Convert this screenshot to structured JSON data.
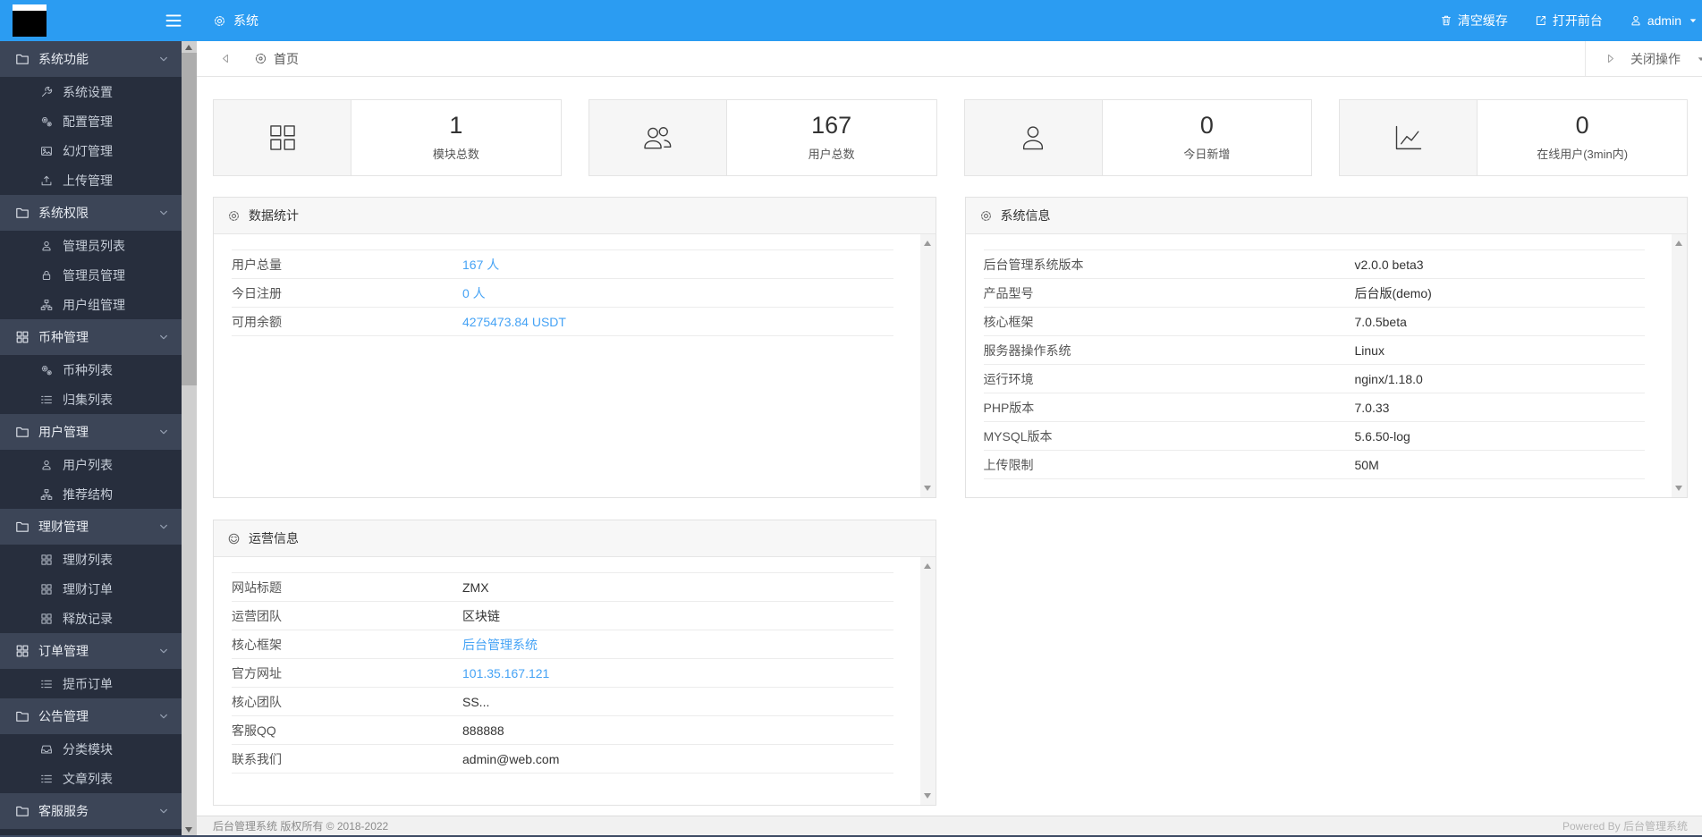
{
  "colors": {
    "accent": "#2b9cf2",
    "link": "#46a3f5",
    "sidebar_bg": "#272e3d",
    "sidebar_group_bg": "#3c4557"
  },
  "header": {
    "app_tab": {
      "label": "系统",
      "icon": "gear"
    },
    "menu_icon": "hamburger",
    "actions": [
      {
        "label": "清空缓存",
        "icon": "trash"
      },
      {
        "label": "打开前台",
        "icon": "external"
      },
      {
        "label": "admin",
        "icon": "person",
        "caret": "caret"
      }
    ]
  },
  "tabbar": {
    "back_icon": "tri-left",
    "home_tab": {
      "label": "首页",
      "icon": "home"
    },
    "ops": {
      "label": "关闭操作",
      "icon": "tri-right",
      "caret": "caret"
    }
  },
  "sidebar": {
    "groups": [
      {
        "label": "系统功能",
        "icon": "folder",
        "chevron": "chevron-down",
        "items": [
          {
            "label": "系统设置",
            "icon": "wrench"
          },
          {
            "label": "配置管理",
            "icon": "cogs"
          },
          {
            "label": "幻灯管理",
            "icon": "image"
          },
          {
            "label": "上传管理",
            "icon": "upload"
          }
        ]
      },
      {
        "label": "系统权限",
        "icon": "folder",
        "chevron": "chevron-down",
        "items": [
          {
            "label": "管理员列表",
            "icon": "person"
          },
          {
            "label": "管理员管理",
            "icon": "lock"
          },
          {
            "label": "用户组管理",
            "icon": "sitemap"
          }
        ]
      },
      {
        "label": "币种管理",
        "icon": "grid",
        "chevron": "chevron-down",
        "items": [
          {
            "label": "币种列表",
            "icon": "cogs"
          },
          {
            "label": "归集列表",
            "icon": "list"
          }
        ]
      },
      {
        "label": "用户管理",
        "icon": "folder",
        "chevron": "chevron-down",
        "items": [
          {
            "label": "用户列表",
            "icon": "person"
          },
          {
            "label": "推荐结构",
            "icon": "sitemap"
          }
        ]
      },
      {
        "label": "理财管理",
        "icon": "folder",
        "chevron": "chevron-down",
        "items": [
          {
            "label": "理财列表",
            "icon": "grid"
          },
          {
            "label": "理财订单",
            "icon": "grid"
          },
          {
            "label": "释放记录",
            "icon": "grid"
          }
        ]
      },
      {
        "label": "订单管理",
        "icon": "grid",
        "chevron": "chevron-down",
        "items": [
          {
            "label": "提币订单",
            "icon": "list"
          }
        ]
      },
      {
        "label": "公告管理",
        "icon": "folder",
        "chevron": "chevron-down",
        "items": [
          {
            "label": "分类模块",
            "icon": "inbox"
          },
          {
            "label": "文章列表",
            "icon": "list"
          }
        ]
      },
      {
        "label": "客服服务",
        "icon": "folder",
        "chevron": "chevron-down",
        "items": []
      }
    ]
  },
  "stats": [
    {
      "icon": "grid",
      "value": "1",
      "label": "模块总数"
    },
    {
      "icon": "users",
      "value": "167",
      "label": "用户总数"
    },
    {
      "icon": "person",
      "value": "0",
      "label": "今日新增"
    },
    {
      "icon": "chart",
      "value": "0",
      "label": "在线用户(3min内)"
    }
  ],
  "panels": {
    "data_stats": {
      "title": "数据统计",
      "icon": "gear",
      "rows": [
        {
          "label": "用户总量",
          "value": "167 人",
          "link": true
        },
        {
          "label": "今日注册",
          "value": "0 人",
          "link": true
        },
        {
          "label": "可用余额",
          "value": "4275473.84 USDT",
          "link": true
        }
      ]
    },
    "system_info": {
      "title": "系统信息",
      "icon": "gear",
      "rows": [
        {
          "label": "后台管理系统版本",
          "value": "v2.0.0 beta3"
        },
        {
          "label": "产品型号",
          "value": "后台版(demo)"
        },
        {
          "label": "核心框架",
          "value": "7.0.5beta"
        },
        {
          "label": "服务器操作系统",
          "value": "Linux"
        },
        {
          "label": "运行环境",
          "value": "nginx/1.18.0"
        },
        {
          "label": "PHP版本",
          "value": "7.0.33"
        },
        {
          "label": "MYSQL版本",
          "value": "5.6.50-log"
        },
        {
          "label": "上传限制",
          "value": "50M"
        }
      ]
    },
    "op_info": {
      "title": "运营信息",
      "icon": "grin",
      "rows": [
        {
          "label": "网站标题",
          "value": "ZMX"
        },
        {
          "label": "运营团队",
          "value": "区块链"
        },
        {
          "label": "核心框架",
          "value": "后台管理系统",
          "link": true
        },
        {
          "label": "官方网址",
          "value": "101.35.167.121",
          "link": true
        },
        {
          "label": "核心团队",
          "value": "SS..."
        },
        {
          "label": "客服QQ",
          "value": "888888"
        },
        {
          "label": "联系我们",
          "value": "admin@web.com"
        }
      ]
    }
  },
  "footer": {
    "left": "后台管理系统 版权所有 © 2018-2022",
    "right": "Powered By 后台管理系统"
  }
}
